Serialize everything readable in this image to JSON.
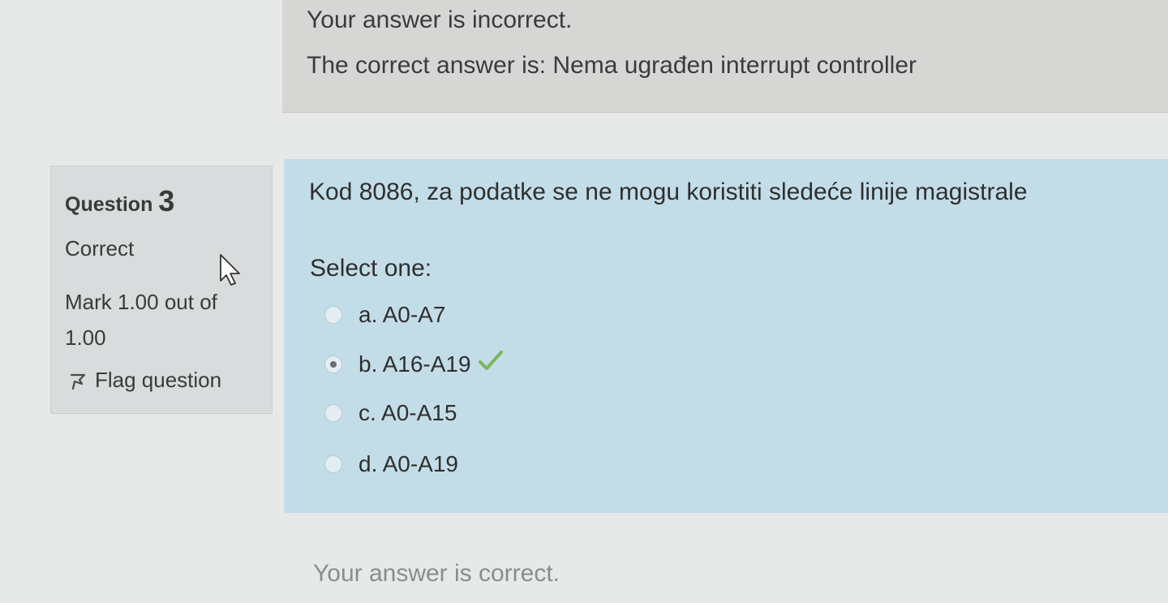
{
  "previous_feedback": {
    "status_text": "Your answer is incorrect.",
    "correct_answer_text": "The correct answer is: Nema ugrađen interrupt controller"
  },
  "question_info": {
    "label": "Question",
    "number": "3",
    "state": "Correct",
    "grade": "Mark 1.00 out of 1.00",
    "flag_label": "Flag question"
  },
  "question": {
    "text": "Kod 8086, za podatke se ne mogu koristiti sledeće linije magistrale",
    "prompt": "Select one:",
    "options": [
      {
        "label": "a. A0-A7",
        "selected": false
      },
      {
        "label": "b. A16-A19",
        "selected": true,
        "marked_correct": true
      },
      {
        "label": "c. A0-A15",
        "selected": false
      },
      {
        "label": "d. A0-A19",
        "selected": false
      }
    ]
  },
  "feedback": {
    "status_text": "Your answer is correct."
  },
  "colors": {
    "content_bg": "#c3dde8",
    "info_bg": "#d8dcdd",
    "check_green": "#7ab55c"
  }
}
